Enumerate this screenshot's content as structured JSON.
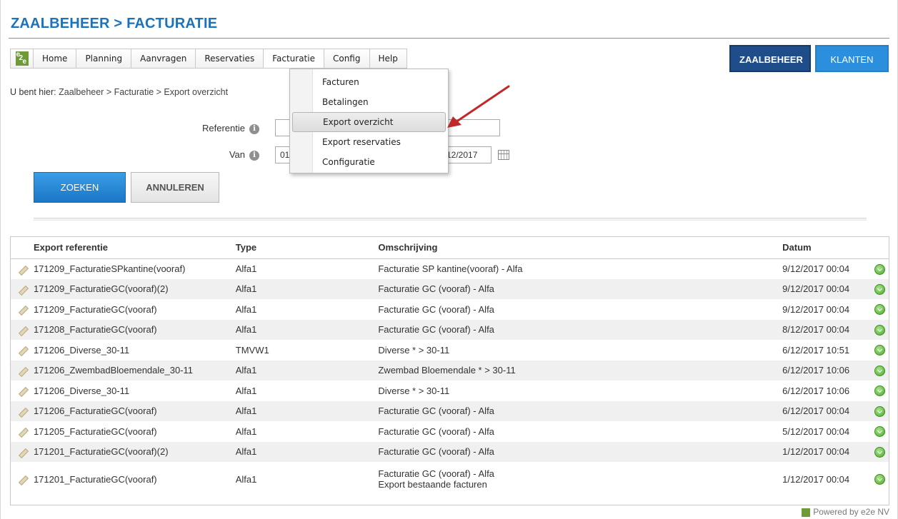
{
  "page": {
    "title": "ZAALBEHEER > FACTURATIE",
    "footer": "Powered by e2e NV"
  },
  "nav": {
    "logo": "e2e",
    "items": [
      "Home",
      "Planning",
      "Aanvragen",
      "Reservaties",
      "Facturatie",
      "Config",
      "Help"
    ],
    "active": "Facturatie"
  },
  "top_buttons": {
    "zaalbeheer": "ZAALBEHEER",
    "klanten": "KLANTEN"
  },
  "breadcrumb": {
    "prefix": "U bent hier:",
    "path": "Zaalbeheer > Facturatie > Export overzicht"
  },
  "dropdown": {
    "items": [
      "Facturen",
      "Betalingen",
      "Export overzicht",
      "Export reservaties",
      "Configuratie"
    ],
    "highlighted": "Export overzicht"
  },
  "form": {
    "referentie_label": "Referentie",
    "referentie_value": "",
    "van_label": "Van",
    "van_value": "01",
    "tot_value": "12/2017",
    "search_button": "ZOEKEN",
    "cancel_button": "ANNULEREN"
  },
  "table": {
    "headers": [
      "Export referentie",
      "Type",
      "Omschrijving",
      "Datum"
    ],
    "rows": [
      {
        "ref": "171209_FacturatieSPkantine(vooraf)",
        "type": "Alfa1",
        "desc": "Facturatie SP kantine(vooraf) - Alfa",
        "desc2": "",
        "date": "9/12/2017 00:04"
      },
      {
        "ref": "171209_FacturatieGC(vooraf)(2)",
        "type": "Alfa1",
        "desc": "Facturatie GC (vooraf) - Alfa",
        "desc2": "",
        "date": "9/12/2017 00:04"
      },
      {
        "ref": "171209_FacturatieGC(vooraf)",
        "type": "Alfa1",
        "desc": "Facturatie GC (vooraf) - Alfa",
        "desc2": "",
        "date": "9/12/2017 00:04"
      },
      {
        "ref": "171208_FacturatieGC(vooraf)",
        "type": "Alfa1",
        "desc": "Facturatie GC (vooraf) - Alfa",
        "desc2": "",
        "date": "8/12/2017 00:04"
      },
      {
        "ref": "171206_Diverse_30-11",
        "type": "TMVW1",
        "desc": "Diverse * > 30-11",
        "desc2": "",
        "date": "6/12/2017 10:51"
      },
      {
        "ref": "171206_ZwembadBloemendale_30-11",
        "type": "Alfa1",
        "desc": "Zwembad Bloemendale * > 30-11",
        "desc2": "",
        "date": "6/12/2017 10:06"
      },
      {
        "ref": "171206_Diverse_30-11",
        "type": "Alfa1",
        "desc": "Diverse * > 30-11",
        "desc2": "",
        "date": "6/12/2017 10:06"
      },
      {
        "ref": "171206_FacturatieGC(vooraf)",
        "type": "Alfa1",
        "desc": "Facturatie GC (vooraf) - Alfa",
        "desc2": "",
        "date": "6/12/2017 00:04"
      },
      {
        "ref": "171205_FacturatieGC(vooraf)",
        "type": "Alfa1",
        "desc": "Facturatie GC (vooraf) - Alfa",
        "desc2": "",
        "date": "5/12/2017 00:04"
      },
      {
        "ref": "171201_FacturatieGC(vooraf)(2)",
        "type": "Alfa1",
        "desc": "Facturatie GC (vooraf) - Alfa",
        "desc2": "",
        "date": "1/12/2017 00:04"
      },
      {
        "ref": "171201_FacturatieGC(vooraf)",
        "type": "Alfa1",
        "desc": "Facturatie GC (vooraf) - Alfa",
        "desc2": "Export bestaande facturen",
        "date": "1/12/2017 00:04"
      }
    ]
  },
  "colors": {
    "title": "#1a73bb",
    "primary_button": "#1a77c7",
    "zaalbeheer_button": "#1f4d8a",
    "arrow": "#c0282a"
  },
  "icons": {
    "row_edit": "pencil-icon",
    "row_action": "green-go-icon",
    "info": "info-icon",
    "calendar": "calendar-icon"
  }
}
